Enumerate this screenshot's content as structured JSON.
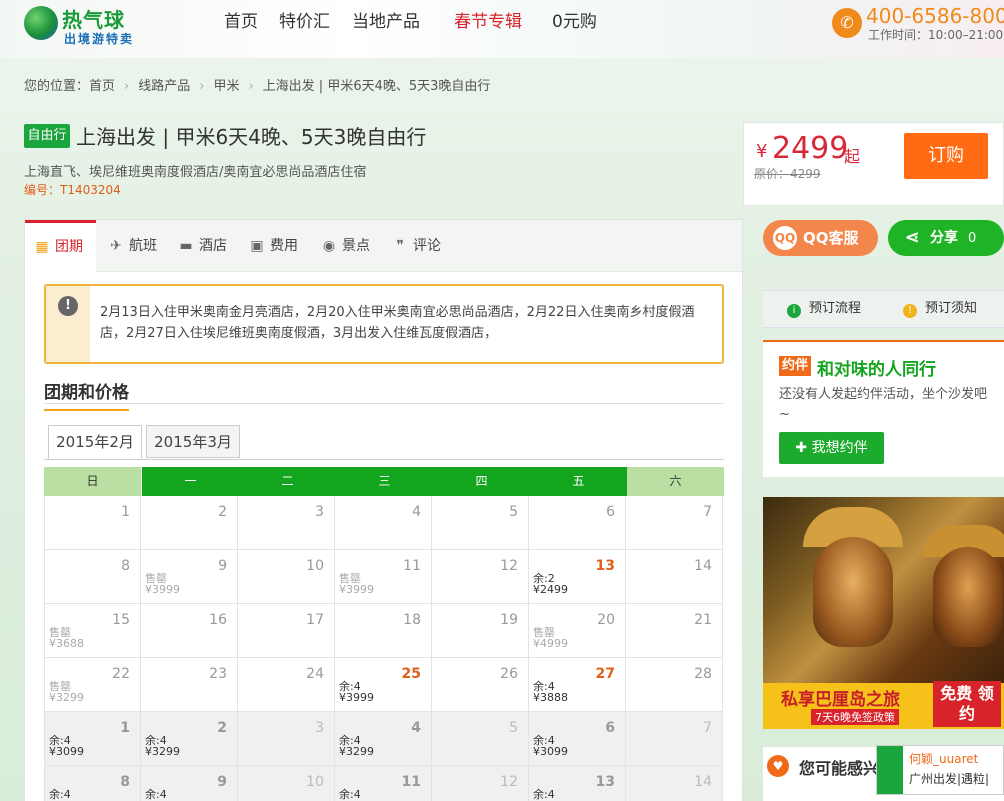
{
  "header": {
    "logo_title": "热气球",
    "logo_sub": "出境游特卖",
    "nav": [
      "首页",
      "特价汇",
      "当地产品",
      "春节专辑",
      "0元购"
    ],
    "phone_icon": "phone-icon",
    "phone": "400-6586-800",
    "work_time": "工作时间：10:00–21:00"
  },
  "breadcrumb": {
    "prefix": "您的位置：",
    "items": [
      "首页",
      "线路产品",
      "甲米",
      "上海出发 | 甲米6天4晚、5天3晚自由行"
    ]
  },
  "product": {
    "tag": "自由行",
    "title": "上海出发 | 甲米6天4晚、5天3晚自由行",
    "subtitle": "上海直飞、埃尼维班奥南度假酒店/奥南宜必思尚品酒店住宿",
    "code": "编号：T1403204"
  },
  "price": {
    "currency": "¥",
    "value": "2499",
    "suffix": "起",
    "original": "原价：4299",
    "order_label": "订购"
  },
  "tabs": [
    {
      "label": "团期",
      "icon": "calendar-icon",
      "glyph": "▦"
    },
    {
      "label": "航班",
      "icon": "plane-icon",
      "glyph": "✈"
    },
    {
      "label": "酒店",
      "icon": "bed-icon",
      "glyph": "▬"
    },
    {
      "label": "费用",
      "icon": "wallet-icon",
      "glyph": "▣"
    },
    {
      "label": "景点",
      "icon": "pin-icon",
      "glyph": "◉"
    },
    {
      "label": "评论",
      "icon": "quote-icon",
      "glyph": "❞"
    }
  ],
  "notice": {
    "icon": "alert-icon",
    "text": "2月13日入住甲米奥南金月亮酒店，2月20入住甲米奥南宜必思尚品酒店，2月22日入住奥南乡村度假酒店，2月27日入住埃尼维班奥南度假酒，3月出发入住维瓦度假酒店，"
  },
  "section_title": "团期和价格",
  "months": [
    "2015年2月",
    "2015年3月"
  ],
  "calendar": {
    "weekdays": [
      "日",
      "一",
      "二",
      "三",
      "四",
      "五",
      "六"
    ],
    "rows": [
      [
        {
          "d": "1"
        },
        {
          "d": "2"
        },
        {
          "d": "3"
        },
        {
          "d": "4"
        },
        {
          "d": "5"
        },
        {
          "d": "6"
        },
        {
          "d": "7"
        }
      ],
      [
        {
          "d": "8"
        },
        {
          "d": "9",
          "s1": "售罄",
          "s2": "¥3999",
          "so": true
        },
        {
          "d": "10"
        },
        {
          "d": "11",
          "s1": "售罄",
          "s2": "¥3999",
          "so": true
        },
        {
          "d": "12"
        },
        {
          "d": "13",
          "s1": "余:2",
          "s2": "¥2499",
          "hl": true
        },
        {
          "d": "14"
        }
      ],
      [
        {
          "d": "15",
          "s1": "售罄",
          "s2": "¥3688",
          "so": true
        },
        {
          "d": "16"
        },
        {
          "d": "17"
        },
        {
          "d": "18"
        },
        {
          "d": "19"
        },
        {
          "d": "20",
          "s1": "售罄",
          "s2": "¥4999",
          "so": true
        },
        {
          "d": "21"
        }
      ],
      [
        {
          "d": "22",
          "s1": "售罄",
          "s2": "¥3299",
          "so": true
        },
        {
          "d": "23"
        },
        {
          "d": "24"
        },
        {
          "d": "25",
          "s1": "余:4",
          "s2": "¥3999",
          "hl": true
        },
        {
          "d": "26"
        },
        {
          "d": "27",
          "s1": "余:4",
          "s2": "¥3888",
          "hl": true
        },
        {
          "d": "28"
        }
      ],
      [
        {
          "d": "1",
          "s1": "余:4",
          "s2": "¥3099",
          "hl": true,
          "nm": true
        },
        {
          "d": "2",
          "s1": "余:4",
          "s2": "¥3299",
          "hl": true,
          "nm": true
        },
        {
          "d": "3",
          "nm": true
        },
        {
          "d": "4",
          "s1": "余:4",
          "s2": "¥3299",
          "hl": true,
          "nm": true
        },
        {
          "d": "5",
          "nm": true
        },
        {
          "d": "6",
          "s1": "余:4",
          "s2": "¥3099",
          "hl": true,
          "nm": true
        },
        {
          "d": "7",
          "nm": true
        }
      ],
      [
        {
          "d": "8",
          "s1": "余:4",
          "hl": true,
          "nm": true
        },
        {
          "d": "9",
          "s1": "余:4",
          "hl": true,
          "nm": true
        },
        {
          "d": "10",
          "nm": true
        },
        {
          "d": "11",
          "s1": "余:4",
          "hl": true,
          "nm": true
        },
        {
          "d": "12",
          "nm": true
        },
        {
          "d": "13",
          "s1": "余:4",
          "hl": true,
          "nm": true
        },
        {
          "d": "14",
          "nm": true
        }
      ]
    ]
  },
  "sidebar": {
    "qq_label": "QQ客服",
    "share_label": "分享",
    "share_count": "0",
    "process": [
      "预订流程",
      "预订须知"
    ],
    "yueban_logo": "约伴",
    "yueban_title": "和对味的人同行",
    "yueban_text": "还没有人发起约伴活动，坐个沙发吧~",
    "yueban_btn": "我想约伴",
    "banner_title": "私享巴厘岛之旅",
    "banner_sub": "7天6晚免签政策",
    "banner_badge": "免费 领约",
    "maybe_title": "您可能感兴",
    "chat_name": "何颖_uuaret",
    "chat_msg": "广州出发|遇粒|"
  },
  "colors": {
    "accent_green": "#14a51f",
    "accent_orange": "#ff6a13",
    "price_red": "#d62a3a"
  }
}
